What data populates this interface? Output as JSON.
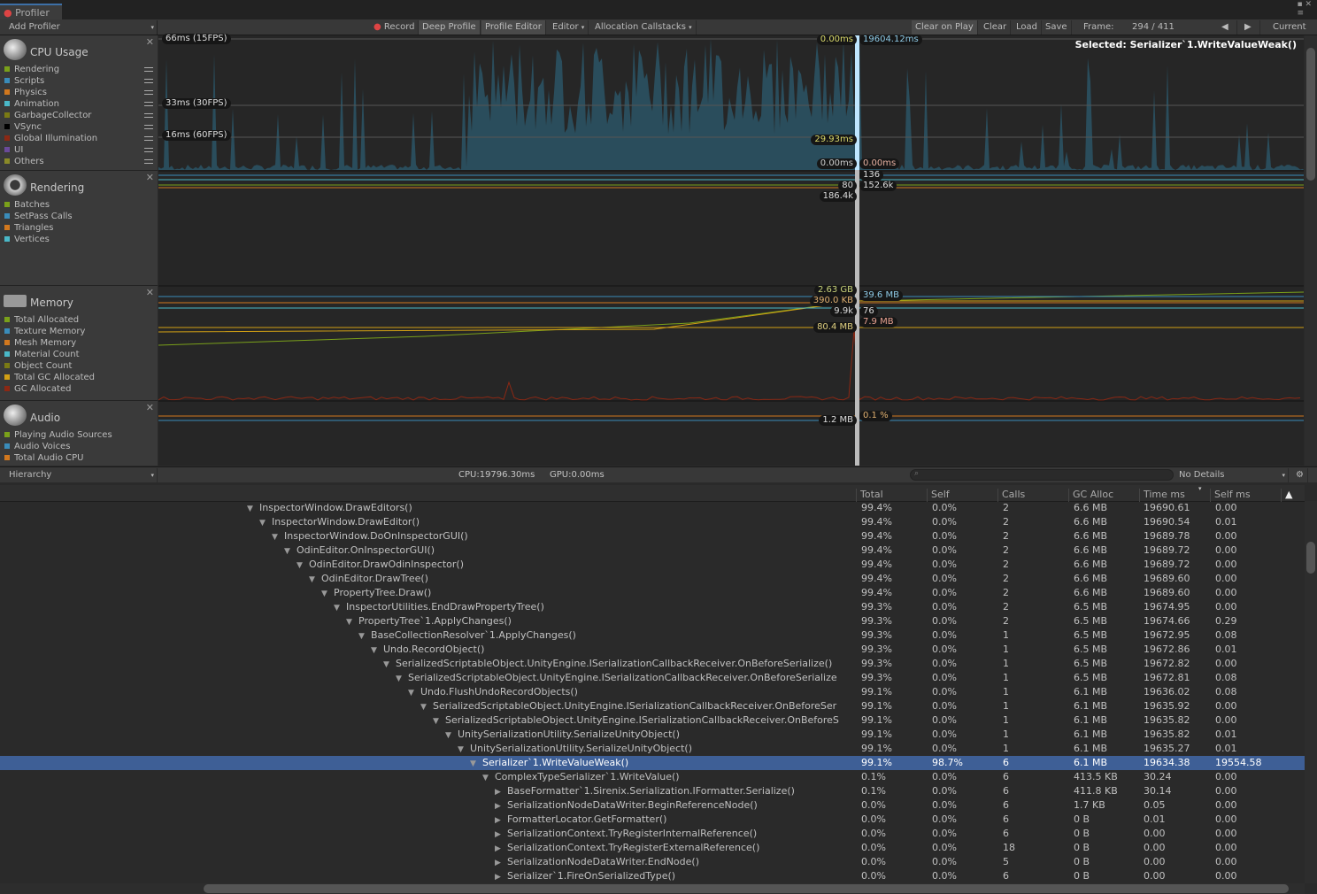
{
  "window": {
    "tab": "Profiler"
  },
  "toolbar": {
    "add_profiler": "Add Profiler",
    "record": "Record",
    "deep_profile": "Deep Profile",
    "profile_editor": "Profile Editor",
    "editor": "Editor",
    "allocation_callstacks": "Allocation Callstacks",
    "clear_on_play": "Clear on Play",
    "clear": "Clear",
    "load": "Load",
    "save": "Save",
    "frame_label": "Frame:",
    "frame_value": "294 / 411",
    "current": "Current"
  },
  "colors": {
    "cpu_fill": "#2a4d5c",
    "selection": "#3e5f96",
    "cursor": "#bfe6ff"
  },
  "sections": [
    {
      "title": "CPU Usage",
      "legend": [
        {
          "label": "Rendering",
          "color": "#7aa01a"
        },
        {
          "label": "Scripts",
          "color": "#3a8cba"
        },
        {
          "label": "Physics",
          "color": "#d2781e"
        },
        {
          "label": "Animation",
          "color": "#4ab8c8"
        },
        {
          "label": "GarbageCollector",
          "color": "#7a7a14"
        },
        {
          "label": "VSync",
          "color": "#000000"
        },
        {
          "label": "Global Illumination",
          "color": "#8c2814"
        },
        {
          "label": "UI",
          "color": "#6a4a9a"
        },
        {
          "label": "Others",
          "color": "#8a8a28"
        }
      ]
    },
    {
      "title": "Rendering",
      "legend": [
        {
          "label": "Batches",
          "color": "#7aa01a"
        },
        {
          "label": "SetPass Calls",
          "color": "#3a8cba"
        },
        {
          "label": "Triangles",
          "color": "#d2781e"
        },
        {
          "label": "Vertices",
          "color": "#4ab8c8"
        }
      ]
    },
    {
      "title": "Memory",
      "legend": [
        {
          "label": "Total Allocated",
          "color": "#7aa01a"
        },
        {
          "label": "Texture Memory",
          "color": "#3a8cba"
        },
        {
          "label": "Mesh Memory",
          "color": "#d2781e"
        },
        {
          "label": "Material Count",
          "color": "#4ab8c8"
        },
        {
          "label": "Object Count",
          "color": "#7a7a14"
        },
        {
          "label": "Total GC Allocated",
          "color": "#d2a014"
        },
        {
          "label": "GC Allocated",
          "color": "#8c2814"
        }
      ]
    },
    {
      "title": "Audio",
      "legend": [
        {
          "label": "Playing Audio Sources",
          "color": "#7aa01a"
        },
        {
          "label": "Audio Voices",
          "color": "#3a8cba"
        },
        {
          "label": "Total Audio CPU",
          "color": "#d2781e"
        }
      ]
    }
  ],
  "cpu_chart": {
    "fps66": "66ms (15FPS)",
    "fps33": "33ms (30FPS)",
    "fps16": "16ms (60FPS)",
    "l1": "0.00ms",
    "r1": "19604.12ms",
    "l2": "29.93ms",
    "l3": "0.00ms",
    "r3": "0.00ms",
    "selected": "Selected: Serializer`1.WriteValueWeak()"
  },
  "render_chart": {
    "r1": "136",
    "l2": "80",
    "r2": "152.6k",
    "l3": "186.4k"
  },
  "memory_chart": {
    "l1": "2.63 GB",
    "r1": "39.6 MB",
    "l2": "390.0 KB",
    "l3": "9.9k",
    "r3": "76",
    "r4": "7.9 MB",
    "l4": "80.4 MB"
  },
  "audio_chart": {
    "r1": "0.1 %",
    "l1": "1.2 MB"
  },
  "bottom": {
    "view": "Hierarchy",
    "cpu": "CPU:19796.30ms",
    "gpu": "GPU:0.00ms",
    "search_placeholder": "",
    "details": "No Details"
  },
  "columns": [
    "Total",
    "Self",
    "Calls",
    "GC Alloc",
    "Time ms",
    "Self ms"
  ],
  "rows": [
    {
      "name": "InspectorWindow.DrawEditors()",
      "depth": 0,
      "open": true,
      "v": [
        "99.4%",
        "0.0%",
        "2",
        "6.6 MB",
        "19690.61",
        "0.00"
      ]
    },
    {
      "name": "InspectorWindow.DrawEditor()",
      "depth": 1,
      "open": true,
      "v": [
        "99.4%",
        "0.0%",
        "2",
        "6.6 MB",
        "19690.54",
        "0.01"
      ]
    },
    {
      "name": "InspectorWindow.DoOnInspectorGUI()",
      "depth": 2,
      "open": true,
      "v": [
        "99.4%",
        "0.0%",
        "2",
        "6.6 MB",
        "19689.78",
        "0.00"
      ]
    },
    {
      "name": "OdinEditor.OnInspectorGUI()",
      "depth": 3,
      "open": true,
      "v": [
        "99.4%",
        "0.0%",
        "2",
        "6.6 MB",
        "19689.72",
        "0.00"
      ]
    },
    {
      "name": "OdinEditor.DrawOdinInspector()",
      "depth": 4,
      "open": true,
      "v": [
        "99.4%",
        "0.0%",
        "2",
        "6.6 MB",
        "19689.72",
        "0.00"
      ]
    },
    {
      "name": "OdinEditor.DrawTree()",
      "depth": 5,
      "open": true,
      "v": [
        "99.4%",
        "0.0%",
        "2",
        "6.6 MB",
        "19689.60",
        "0.00"
      ]
    },
    {
      "name": "PropertyTree.Draw()",
      "depth": 6,
      "open": true,
      "v": [
        "99.4%",
        "0.0%",
        "2",
        "6.6 MB",
        "19689.60",
        "0.00"
      ]
    },
    {
      "name": "InspectorUtilities.EndDrawPropertyTree()",
      "depth": 7,
      "open": true,
      "v": [
        "99.3%",
        "0.0%",
        "2",
        "6.5 MB",
        "19674.95",
        "0.00"
      ]
    },
    {
      "name": "PropertyTree`1.ApplyChanges()",
      "depth": 8,
      "open": true,
      "v": [
        "99.3%",
        "0.0%",
        "2",
        "6.5 MB",
        "19674.66",
        "0.29"
      ]
    },
    {
      "name": "BaseCollectionResolver`1.ApplyChanges()",
      "depth": 9,
      "open": true,
      "v": [
        "99.3%",
        "0.0%",
        "1",
        "6.5 MB",
        "19672.95",
        "0.08"
      ]
    },
    {
      "name": "Undo.RecordObject()",
      "depth": 10,
      "open": true,
      "v": [
        "99.3%",
        "0.0%",
        "1",
        "6.5 MB",
        "19672.86",
        "0.01"
      ]
    },
    {
      "name": "SerializedScriptableObject.UnityEngine.ISerializationCallbackReceiver.OnBeforeSerialize()",
      "depth": 11,
      "open": true,
      "v": [
        "99.3%",
        "0.0%",
        "1",
        "6.5 MB",
        "19672.82",
        "0.00"
      ]
    },
    {
      "name": "SerializedScriptableObject.UnityEngine.ISerializationCallbackReceiver.OnBeforeSerialize",
      "depth": 12,
      "open": true,
      "v": [
        "99.3%",
        "0.0%",
        "1",
        "6.5 MB",
        "19672.81",
        "0.08"
      ]
    },
    {
      "name": "Undo.FlushUndoRecordObjects()",
      "depth": 13,
      "open": true,
      "v": [
        "99.1%",
        "0.0%",
        "1",
        "6.1 MB",
        "19636.02",
        "0.08"
      ]
    },
    {
      "name": "SerializedScriptableObject.UnityEngine.ISerializationCallbackReceiver.OnBeforeSer",
      "depth": 14,
      "open": true,
      "v": [
        "99.1%",
        "0.0%",
        "1",
        "6.1 MB",
        "19635.92",
        "0.00"
      ]
    },
    {
      "name": "SerializedScriptableObject.UnityEngine.ISerializationCallbackReceiver.OnBeforeS",
      "depth": 15,
      "open": true,
      "v": [
        "99.1%",
        "0.0%",
        "1",
        "6.1 MB",
        "19635.82",
        "0.00"
      ]
    },
    {
      "name": "UnitySerializationUtility.SerializeUnityObject()",
      "depth": 16,
      "open": true,
      "v": [
        "99.1%",
        "0.0%",
        "1",
        "6.1 MB",
        "19635.82",
        "0.01"
      ]
    },
    {
      "name": "UnitySerializationUtility.SerializeUnityObject()",
      "depth": 17,
      "open": true,
      "v": [
        "99.1%",
        "0.0%",
        "1",
        "6.1 MB",
        "19635.27",
        "0.01"
      ]
    },
    {
      "name": "Serializer`1.WriteValueWeak()",
      "depth": 18,
      "open": true,
      "selected": true,
      "v": [
        "99.1%",
        "98.7%",
        "6",
        "6.1 MB",
        "19634.38",
        "19554.58"
      ]
    },
    {
      "name": "ComplexTypeSerializer`1.WriteValue()",
      "depth": 19,
      "open": true,
      "v": [
        "0.1%",
        "0.0%",
        "6",
        "413.5 KB",
        "30.24",
        "0.00"
      ]
    },
    {
      "name": "BaseFormatter`1.Sirenix.Serialization.IFormatter.Serialize()",
      "depth": 20,
      "open": false,
      "v": [
        "0.1%",
        "0.0%",
        "6",
        "411.8 KB",
        "30.14",
        "0.00"
      ]
    },
    {
      "name": "SerializationNodeDataWriter.BeginReferenceNode()",
      "depth": 20,
      "open": false,
      "v": [
        "0.0%",
        "0.0%",
        "6",
        "1.7 KB",
        "0.05",
        "0.00"
      ]
    },
    {
      "name": "FormatterLocator.GetFormatter()",
      "depth": 20,
      "open": false,
      "v": [
        "0.0%",
        "0.0%",
        "6",
        "0 B",
        "0.01",
        "0.00"
      ]
    },
    {
      "name": "SerializationContext.TryRegisterInternalReference()",
      "depth": 20,
      "open": false,
      "v": [
        "0.0%",
        "0.0%",
        "6",
        "0 B",
        "0.00",
        "0.00"
      ]
    },
    {
      "name": "SerializationContext.TryRegisterExternalReference()",
      "depth": 20,
      "open": false,
      "v": [
        "0.0%",
        "0.0%",
        "18",
        "0 B",
        "0.00",
        "0.00"
      ]
    },
    {
      "name": "SerializationNodeDataWriter.EndNode()",
      "depth": 20,
      "open": false,
      "v": [
        "0.0%",
        "0.0%",
        "5",
        "0 B",
        "0.00",
        "0.00"
      ]
    },
    {
      "name": "Serializer`1.FireOnSerializedType()",
      "depth": 20,
      "open": false,
      "v": [
        "0.0%",
        "0.0%",
        "6",
        "0 B",
        "0.00",
        "0.00"
      ]
    }
  ]
}
